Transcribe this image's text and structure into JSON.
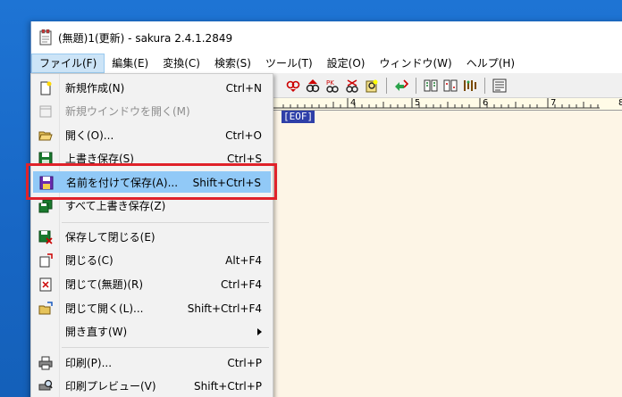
{
  "window": {
    "title": "(無題)1(更新) - sakura 2.4.1.2849"
  },
  "menubar": {
    "items": [
      {
        "label": "ファイル(F)"
      },
      {
        "label": "編集(E)"
      },
      {
        "label": "変換(C)"
      },
      {
        "label": "検索(S)"
      },
      {
        "label": "ツール(T)"
      },
      {
        "label": "設定(O)"
      },
      {
        "label": "ウィンドウ(W)"
      },
      {
        "label": "ヘルプ(H)"
      }
    ]
  },
  "ruler": {
    "labels": [
      "4",
      "5",
      "6",
      "7",
      "8"
    ]
  },
  "editor": {
    "eof_marker": "[EOF]"
  },
  "file_menu": {
    "items": [
      {
        "label": "新規作成(N)",
        "shortcut": "Ctrl+N",
        "icon": "new-file-icon"
      },
      {
        "label": "新規ウインドウを開く(M)",
        "shortcut": "",
        "icon": "new-window-icon",
        "disabled": true
      },
      {
        "label": "開く(O)...",
        "shortcut": "Ctrl+O",
        "icon": "open-folder-icon"
      },
      {
        "label": "上書き保存(S)",
        "shortcut": "Ctrl+S",
        "icon": "save-icon"
      },
      {
        "label": "名前を付けて保存(A)...",
        "shortcut": "Shift+Ctrl+S",
        "icon": "save-as-icon",
        "highlighted": true
      },
      {
        "label": "すべて上書き保存(Z)",
        "shortcut": "",
        "icon": "save-all-icon"
      },
      {
        "label": "保存して閉じる(E)",
        "shortcut": "",
        "icon": "save-close-icon"
      },
      {
        "label": "閉じる(C)",
        "shortcut": "Alt+F4",
        "icon": "close-doc-icon"
      },
      {
        "label": "閉じて(無題)(R)",
        "shortcut": "Ctrl+F4",
        "icon": "close-untitled-icon"
      },
      {
        "label": "閉じて開く(L)...",
        "shortcut": "Shift+Ctrl+F4",
        "icon": "close-open-icon"
      },
      {
        "label": "開き直す(W)",
        "shortcut": "",
        "icon": "",
        "submenu": true
      },
      {
        "label": "印刷(P)...",
        "shortcut": "Ctrl+P",
        "icon": "print-icon"
      },
      {
        "label": "印刷プレビュー(V)",
        "shortcut": "Shift+Ctrl+P",
        "icon": "print-preview-icon"
      }
    ]
  },
  "colors": {
    "desktop": "#1766c4",
    "highlight": "#91c9f7",
    "annotation_box": "#e0222a",
    "eof_bg": "#2e3fa8",
    "editor_bg": "#fdf5e6"
  }
}
